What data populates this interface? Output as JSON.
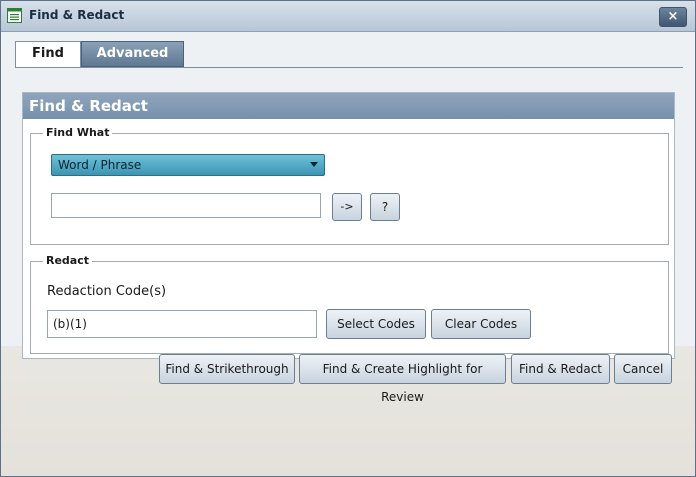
{
  "window": {
    "title": "Find & Redact",
    "close_label": "×"
  },
  "tabs": [
    {
      "label": "Find",
      "selected": true
    },
    {
      "label": "Advanced",
      "selected": false
    }
  ],
  "panel": {
    "title": "Find & Redact",
    "find_what": {
      "legend": "Find What",
      "dropdown": {
        "selected": "Word / Phrase"
      },
      "search_value": "",
      "arrow_button": "->",
      "help_button": "?"
    },
    "redact": {
      "legend": "Redact",
      "codes_label": "Redaction Code(s)",
      "codes_value": "(b)(1)",
      "select_codes": "Select Codes",
      "clear_codes": "Clear Codes"
    }
  },
  "actions": {
    "strikethrough": "Find & Strikethrough",
    "highlight": "Find & Create Highlight for Review",
    "redact": "Find & Redact",
    "cancel": "Cancel"
  },
  "colors": {
    "titlebar": "#b7c6d6",
    "panel_header": "#7f97b0",
    "dropdown": "#4aa3c0",
    "tab_active": "#ffffff",
    "tab_inactive": "#6f869f"
  },
  "icons": {
    "window": "list-window-icon",
    "dropdown": "chevron-down-icon"
  }
}
